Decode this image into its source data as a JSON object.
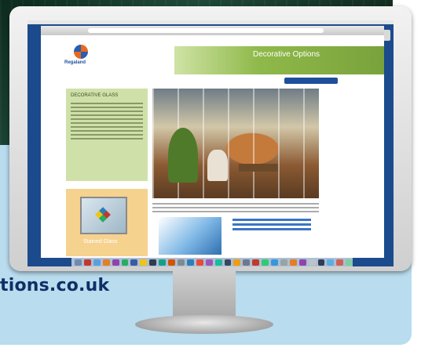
{
  "website_url": "tions.co.uk",
  "brand": {
    "name": "Regaland"
  },
  "banner": {
    "title": "Decorative Options",
    "subtitle": ""
  },
  "sidebar": {
    "title": "DECORATIVE GLASS",
    "promo_label": "Stained Glass"
  },
  "icons": {
    "logo": "company-logo-icon",
    "desktop_drive": "hard-drive-icon"
  }
}
